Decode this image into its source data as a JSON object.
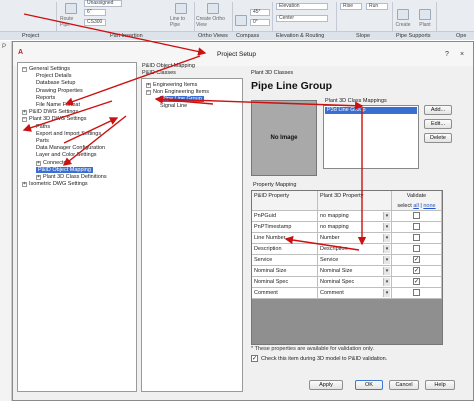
{
  "ribbon": {
    "tools": {
      "route_pipe": "Route Pipe",
      "line_to_pipe": "Line to Pipe",
      "ortho": "Create Ortho View",
      "compass": "Compass",
      "elevation": "Elevation",
      "center": "Center",
      "rise": "Rise",
      "run": "Run",
      "create": "Create",
      "plant": "Plant",
      "top_label": "Unassigned",
      "size_value": "6\"",
      "spec_value": "CS300",
      "angle_value": "45°",
      "snap_value": "0°"
    },
    "groups": [
      "Project",
      "Part Insertion",
      "Ortho Views",
      "Compass",
      "Elevation & Routing",
      "Slope",
      "Pipe Supports",
      "Ope"
    ]
  },
  "left_badge": "P",
  "dialog": {
    "title": "Project Setup",
    "app_icon_glyph": "A",
    "help_button": "?",
    "close_button": "×",
    "settings_tree": [
      {
        "label": "General Settings",
        "toggle": "−",
        "level": 0
      },
      {
        "label": "Project Details",
        "level": 1
      },
      {
        "label": "Database Setup",
        "level": 1
      },
      {
        "label": "Drawing Properties",
        "level": 1
      },
      {
        "label": "Reports",
        "level": 1
      },
      {
        "label": "File Name Format",
        "level": 1
      },
      {
        "label": "P&ID DWG Settings",
        "toggle": "+",
        "level": 0
      },
      {
        "label": "Plant 3D DWG Settings",
        "toggle": "−",
        "level": 0
      },
      {
        "label": "Paths",
        "level": 1
      },
      {
        "label": "Export and Import Settings",
        "level": 1
      },
      {
        "label": "Parts",
        "level": 1
      },
      {
        "label": "Data Manager Configuration",
        "level": 1
      },
      {
        "label": "Layer and Color Settings",
        "level": 1
      },
      {
        "label": "Connectors",
        "toggle": "+",
        "level": 1
      },
      {
        "label": "P&ID Object Mapping",
        "level": 1,
        "selected": true
      },
      {
        "label": "Plant 3D Class Definitions",
        "toggle": "+",
        "level": 1
      },
      {
        "label": "Isometric DWG Settings",
        "toggle": "+",
        "level": 0
      }
    ],
    "mapping": {
      "header": "P&ID Object Mapping",
      "classes_label": "P&ID Classes",
      "tree": [
        {
          "label": "Engineering Items",
          "toggle": "+",
          "level": 0
        },
        {
          "label": "Non Engineering Items",
          "toggle": "−",
          "level": 0
        },
        {
          "label": "Pipe Line Group",
          "level": 1,
          "selected": true
        },
        {
          "label": "Signal Line",
          "level": 1
        }
      ]
    },
    "plant3d": {
      "classes_label": "Plant 3D Classes",
      "group_title": "Pipe Line Group",
      "no_image": "No Image",
      "class_mappings_label": "Plant 3D Class Mappings",
      "class_mappings": [
        "P3d Line Group"
      ],
      "add_button": "Add...",
      "edit_button": "Edit...",
      "delete_button": "Delete",
      "property_mapping_label": "Property Mapping",
      "columns": {
        "pid": "P&ID Property",
        "plant3d": "Plant 3D Property",
        "validate": "Validate",
        "select": "select",
        "all": "all",
        "sep": "|",
        "none": "none"
      },
      "rows": [
        {
          "pid": "PnPGuid",
          "plant3d": "no mapping",
          "checked": false
        },
        {
          "pid": "PnPTimestamp",
          "plant3d": "no mapping",
          "checked": false
        },
        {
          "pid": "Line Number",
          "plant3d": "Number",
          "checked": false
        },
        {
          "pid": "Description",
          "plant3d": "Description",
          "checked": false
        },
        {
          "pid": "Service",
          "plant3d": "Service",
          "checked": true
        },
        {
          "pid": "Nominal Size",
          "plant3d": "Nominal Size",
          "checked": true
        },
        {
          "pid": "Nominal Spec",
          "plant3d": "Nominal Spec",
          "checked": true
        },
        {
          "pid": "Comment",
          "plant3d": "Comment",
          "checked": false
        }
      ],
      "footnote": "* These properties are available for validation only.",
      "validation_check_label": "Check this item during 3D model to P&ID validation.",
      "validation_checked": true
    },
    "buttons": {
      "apply": "Apply",
      "ok": "OK",
      "cancel": "Cancel",
      "help": "Help"
    }
  },
  "colors": {
    "accent": "#3a6fd1",
    "annotation": "#cc1111",
    "panel_gray": "#8f8f8f"
  }
}
